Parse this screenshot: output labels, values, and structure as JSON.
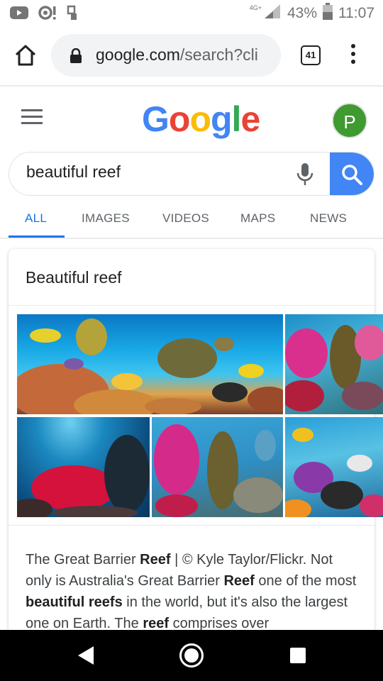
{
  "status_bar": {
    "network": "4G+",
    "battery": "43%",
    "time": "11:07",
    "icons": [
      "youtube-icon",
      "notification-icon",
      "usb-icon",
      "signal-icon",
      "battery-icon"
    ]
  },
  "browser": {
    "url_host": "google.com",
    "url_path": "/search?cli",
    "tab_count": "41"
  },
  "google": {
    "logo": [
      "G",
      "o",
      "o",
      "g",
      "l",
      "e"
    ],
    "logo_colors": [
      "#4285f4",
      "#ea4335",
      "#fbbc05",
      "#4285f4",
      "#34a853",
      "#ea4335"
    ],
    "avatar_letter": "P",
    "avatar_color": "#3f9a2f"
  },
  "search": {
    "query": "beautiful reef"
  },
  "tabs": [
    "ALL",
    "IMAGES",
    "VIDEOS",
    "MAPS",
    "NEWS"
  ],
  "active_tab": "ALL",
  "card": {
    "title": "Beautiful reef",
    "snippet": [
      {
        "t": "The Great Barrier ",
        "b": false
      },
      {
        "t": "Reef",
        "b": true
      },
      {
        "t": " | © Kyle Taylor/Flickr. Not only is Australia's Great Barrier ",
        "b": false
      },
      {
        "t": "Reef",
        "b": true
      },
      {
        "t": " one of the most ",
        "b": false
      },
      {
        "t": "beautiful reefs",
        "b": true
      },
      {
        "t": " in the world, but it's also the largest one on Earth. The ",
        "b": false
      },
      {
        "t": "reef",
        "b": true
      },
      {
        "t": " comprises over",
        "b": false
      }
    ]
  },
  "colors": {
    "accent": "#1a73e8",
    "search_button": "#4285f4"
  }
}
